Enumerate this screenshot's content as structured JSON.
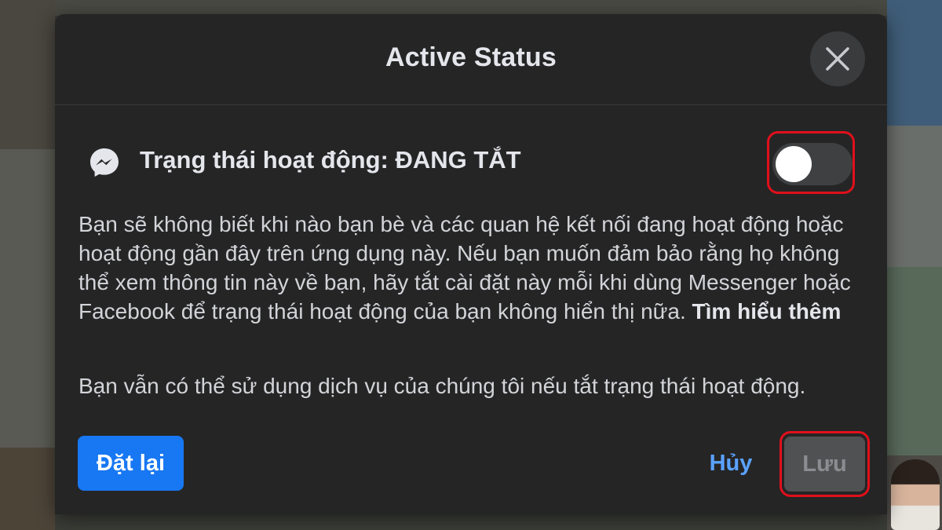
{
  "dialog": {
    "title": "Active Status",
    "close_icon": "close-icon"
  },
  "status_row": {
    "icon": "messenger-icon",
    "label": "Trạng thái hoạt động: ĐANG TẮT",
    "toggle_on": false
  },
  "description": {
    "text": "Bạn sẽ không biết khi nào bạn bè và các quan hệ kết nối đang hoạt động hoặc hoạt động gần đây trên ứng dụng này. Nếu bạn muốn đảm bảo rằng họ không thể xem thông tin này về bạn, hãy tắt cài đặt này mỗi khi dùng Messenger hoặc Facebook để trạng thái hoạt động của bạn không hiển thị nữa.",
    "learn_more": "Tìm hiểu thêm"
  },
  "note": "Bạn vẫn có thể sử dụng dịch vụ của chúng tôi nếu tắt trạng thái hoạt động.",
  "buttons": {
    "reset": "Đặt lại",
    "cancel": "Hủy",
    "save": "Lưu"
  },
  "colors": {
    "dialog_bg": "#252526",
    "primary_blue": "#1877f2",
    "link_blue": "#5aa2ff",
    "highlight_red": "#e0101b"
  }
}
